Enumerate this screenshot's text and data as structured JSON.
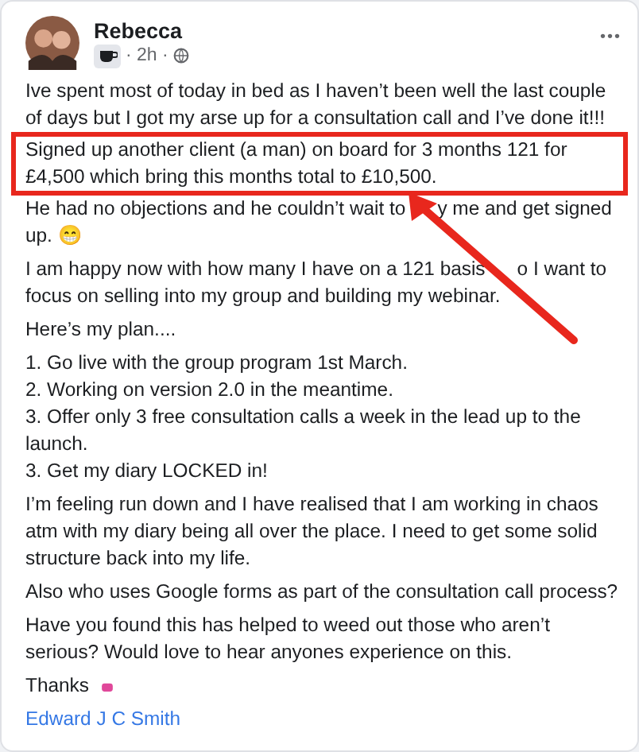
{
  "post": {
    "author": "Rebecca",
    "time": "· 2h ·",
    "more": "•••",
    "blocks": [
      {
        "lines": [
          {
            "segments": [
              "Ive spent most of today in bed as I haven’t been well the last couple of days but I got my arse up for a consultation call and I’ve done it!!!"
            ],
            "highlighted": false
          },
          {
            "segments": [
              "Signed up another client (a man) on board for 3 months 121 for £4,500 which bring this months total to £10,500."
            ],
            "highlighted": true
          },
          {
            "segments": [
              "He had no objections and he couldn’t wait to",
              "y me and get signed up. 😁"
            ],
            "highlighted": false
          }
        ]
      },
      {
        "lines": [
          {
            "segments": [
              "I am happy now with how many I have on a 121 basis",
              "o I want to focus on selling into my group and building my webinar."
            ]
          }
        ]
      },
      {
        "lines": [
          {
            "segments": [
              "Here’s my plan...."
            ]
          }
        ]
      },
      {
        "lines": [
          {
            "segments": [
              "1. Go live with the group program 1st March."
            ]
          },
          {
            "segments": [
              "2. Working on version 2.0 in the meantime."
            ]
          },
          {
            "segments": [
              "3. Offer only 3 free consultation calls a week in the lead up to the launch."
            ]
          },
          {
            "segments": [
              "3. Get my diary LOCKED in!"
            ]
          }
        ]
      },
      {
        "lines": [
          {
            "segments": [
              "I’m feeling run down and I have realised that I am working in chaos atm with my diary being all over the place. I need to get some solid structure back into my life."
            ]
          }
        ]
      },
      {
        "lines": [
          {
            "segments": [
              "Also who uses Google forms as part of the consultation call process?"
            ]
          }
        ]
      },
      {
        "lines": [
          {
            "segments": [
              "Have you found this has helped to weed out those who aren’t serious? Would love to hear anyones experience on this."
            ]
          }
        ]
      }
    ],
    "thanks": "Thanks",
    "tag": "Edward J C Smith"
  }
}
